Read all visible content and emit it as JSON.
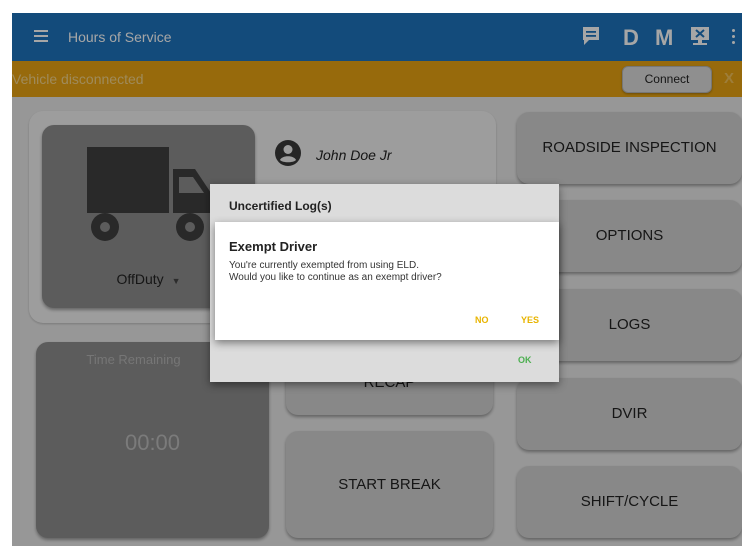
{
  "topbar": {
    "title": "Hours of Service",
    "badge_d": "D",
    "badge_m": "M",
    "color": "#1e73bd"
  },
  "warning": {
    "text": "Vehicle disconnected",
    "connect_label": "Connect",
    "close_label": "X",
    "color": "#e8a413"
  },
  "driver": {
    "name": "John Doe Jr",
    "duty_status": "OffDuty"
  },
  "actions": {
    "roadside": "ROADSIDE INSPECTION",
    "options": "OPTIONS",
    "logs": "LOGS",
    "dvir": "DVIR",
    "shift_cycle": "SHIFT/CYCLE",
    "recap": "RECAP",
    "start_break": "START BREAK"
  },
  "time": {
    "label": "Time Remaining",
    "value": "00:00"
  },
  "dialog_back": {
    "title": "Uncertified Log(s)",
    "ok_label": "OK"
  },
  "dialog_front": {
    "title": "Exempt Driver",
    "message": "You're currently exempted from using ELD.\nWould you like to continue as an exempt driver?",
    "no_label": "NO",
    "yes_label": "YES",
    "accent": "#e8b400"
  }
}
